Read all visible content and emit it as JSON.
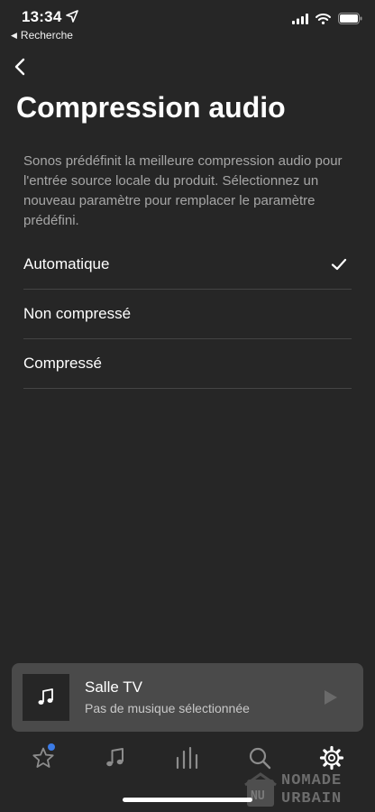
{
  "status_bar": {
    "time": "13:34",
    "back_app": "Recherche"
  },
  "page": {
    "title": "Compression audio",
    "description": "Sonos prédéfinit la meilleure compression audio pour l'entrée source locale du produit. Sélectionnez un nouveau paramètre pour remplacer le paramètre prédéfini."
  },
  "options": [
    {
      "label": "Automatique",
      "selected": true
    },
    {
      "label": "Non compressé",
      "selected": false
    },
    {
      "label": "Compressé",
      "selected": false
    }
  ],
  "now_playing": {
    "room": "Salle TV",
    "status": "Pas de musique sélectionnée"
  },
  "tabs": [
    {
      "icon": "star-icon",
      "badge": true
    },
    {
      "icon": "music-note-icon"
    },
    {
      "icon": "rooms-icon"
    },
    {
      "icon": "search-icon"
    },
    {
      "icon": "gear-icon",
      "active": true
    }
  ],
  "watermark": {
    "line1": "NOMADE",
    "line2": "URBAIN",
    "badge": "NU"
  },
  "colors": {
    "background": "#262626",
    "card": "#4a4a4a",
    "text_secondary": "#a6a6a6",
    "divider": "#444444",
    "badge": "#3b7be6"
  }
}
